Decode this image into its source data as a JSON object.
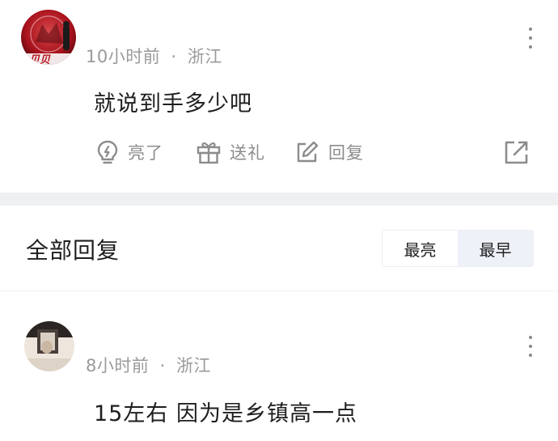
{
  "comment": {
    "avatar_badge": "贝贝",
    "time": "10小时前",
    "separator": "·",
    "location": "浙江",
    "text": "就说到手多少吧",
    "actions": {
      "like_label": "亮了",
      "gift_label": "送礼",
      "reply_label": "回复"
    }
  },
  "replies": {
    "title": "全部回复",
    "sort_options": [
      "最亮",
      "最早"
    ],
    "selected_sort": "最早"
  },
  "reply": {
    "time": "8小时前",
    "separator": "·",
    "location": "浙江",
    "text": "15左右 因为是乡镇高一点"
  },
  "colors": {
    "divider": "#eff0f2",
    "meta_text": "#9a9a9a",
    "icon": "#8c8c8c",
    "active_sort_bg": "#eef1f8"
  }
}
